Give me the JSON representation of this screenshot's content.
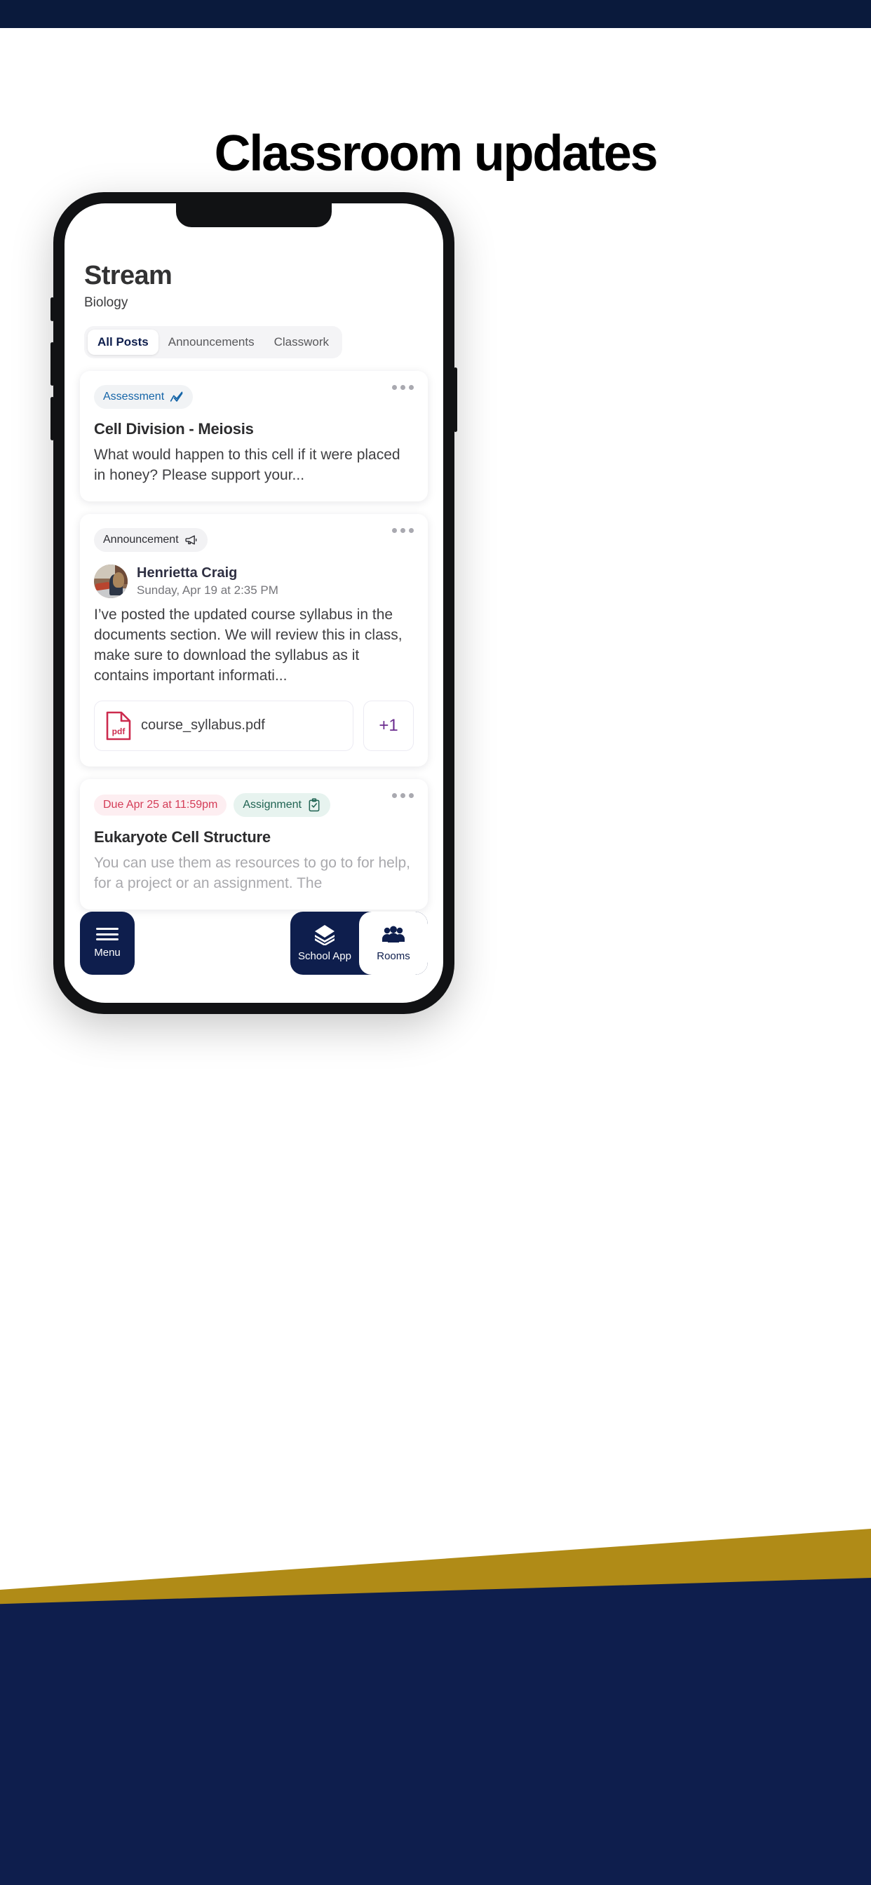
{
  "page": {
    "headline": "Classroom updates"
  },
  "colors": {
    "navy": "#0e1e4d",
    "gold": "#b08b17",
    "assessment_blue": "#1565a8",
    "assignment_green": "#1f6352",
    "due_red": "#d43c57",
    "pdf_red": "#cc2b4e",
    "plus_purple": "#6b2c8f"
  },
  "app": {
    "title": "Stream",
    "course": "Biology",
    "tabs": [
      {
        "label": "All Posts",
        "active": true
      },
      {
        "label": "Announcements",
        "active": false
      },
      {
        "label": "Classwork",
        "active": false
      }
    ],
    "posts": [
      {
        "badge": {
          "label": "Assessment",
          "icon": "trend-check-icon"
        },
        "title": "Cell Division - Meiosis",
        "body": "What would happen to this cell if it were placed in honey? Please support your...",
        "menu_icon": "kebab-menu-icon"
      },
      {
        "badge": {
          "label": "Announcement",
          "icon": "megaphone-icon"
        },
        "author": {
          "name": "Henrietta Craig",
          "timestamp": "Sunday, Apr 19 at 2:35 PM",
          "avatar_icon": "avatar-photo"
        },
        "body": "I’ve posted the updated course syllabus in the documents section. We will review this in class, make sure to download the syllabus as it contains important informati...",
        "attachments": [
          {
            "name": "course_syllabus.pdf",
            "icon": "pdf-file-icon"
          }
        ],
        "more_attachments_label": "+1",
        "menu_icon": "kebab-menu-icon"
      },
      {
        "due_badge": "Due Apr 25 at 11:59pm",
        "badge": {
          "label": "Assignment",
          "icon": "clipboard-check-icon"
        },
        "title": "Eukaryote Cell Structure",
        "body": "You can use them as resources to go to for help, for a project or an assignment. The",
        "menu_icon": "kebab-menu-icon"
      }
    ],
    "bottom_nav": {
      "menu": {
        "label": "Menu",
        "icon": "hamburger-icon"
      },
      "items": [
        {
          "label": "School App",
          "icon": "layers-icon",
          "active": false
        },
        {
          "label": "Rooms",
          "icon": "people-icon",
          "active": true
        }
      ]
    }
  }
}
